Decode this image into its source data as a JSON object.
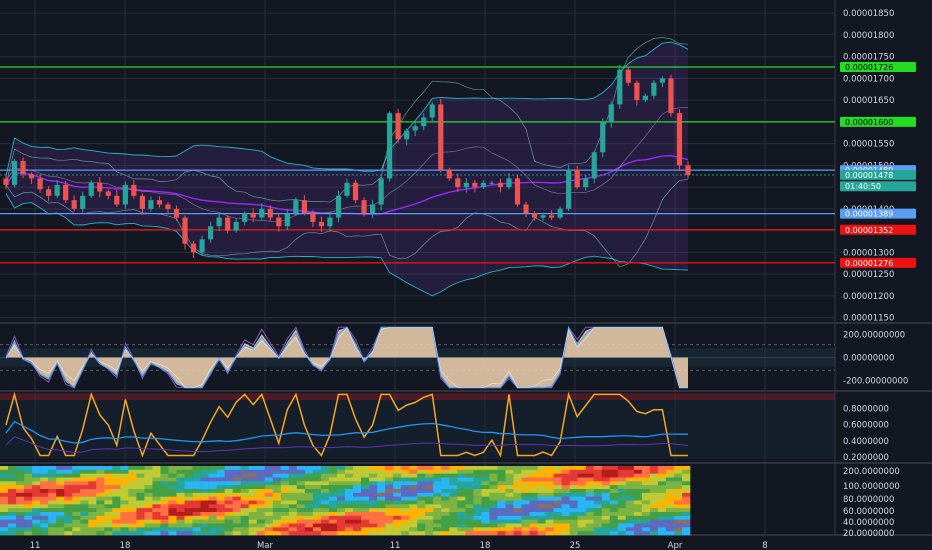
{
  "chart_data": [
    {
      "type": "candlestick",
      "panel": "price",
      "y_axis_ticks": [
        "0.00001850",
        "0.00001800",
        "0.00001750",
        "0.00001700",
        "0.00001650",
        "0.00001600",
        "0.00001550",
        "0.00001500",
        "0.00001450",
        "0.00001400",
        "0.00001350",
        "0.00001300",
        "0.00001250",
        "0.00001200",
        "0.00001150"
      ],
      "ylim": [
        1.14e-05,
        1.88e-05
      ],
      "x_axis_ticks": [
        "11",
        "18",
        "Mar",
        "11",
        "18",
        "25",
        "Apr",
        "8"
      ],
      "horizontal_levels": [
        {
          "value": 1.726e-05,
          "label": "0.00001726",
          "color": "#22dd22"
        },
        {
          "value": 1.6e-05,
          "label": "0.00001600",
          "color": "#22dd22"
        },
        {
          "value": 1.489e-05,
          "label": "0.00001489",
          "color": "#5b9cf6"
        },
        {
          "value": 1.389e-05,
          "label": "0.00001389",
          "color": "#5b9cf6"
        },
        {
          "value": 1.352e-05,
          "label": "0.00001352",
          "color": "#ee1111"
        },
        {
          "value": 1.276e-05,
          "label": "0.00001276",
          "color": "#ee1111"
        }
      ],
      "price_tags": [
        {
          "value": 1.478e-05,
          "label": "0.00001478",
          "color": "#26a69a"
        },
        {
          "value": 1.452e-05,
          "label": "01:40:50",
          "color": "#26a69a"
        }
      ],
      "candle_closes": [
        1.455e-05,
        1.51e-05,
        1.48e-05,
        1.47e-05,
        1.445e-05,
        1.43e-05,
        1.455e-05,
        1.42e-05,
        1.4e-05,
        1.43e-05,
        1.46e-05,
        1.44e-05,
        1.43e-05,
        1.41e-05,
        1.455e-05,
        1.43e-05,
        1.4e-05,
        1.42e-05,
        1.41e-05,
        1.4e-05,
        1.38e-05,
        1.32e-05,
        1.3e-05,
        1.33e-05,
        1.36e-05,
        1.38e-05,
        1.35e-05,
        1.37e-05,
        1.39e-05,
        1.38e-05,
        1.4e-05,
        1.38e-05,
        1.36e-05,
        1.39e-05,
        1.42e-05,
        1.39e-05,
        1.37e-05,
        1.36e-05,
        1.38e-05,
        1.43e-05,
        1.46e-05,
        1.42e-05,
        1.39e-05,
        1.41e-05,
        1.47e-05,
        1.62e-05,
        1.56e-05,
        1.58e-05,
        1.59e-05,
        1.61e-05,
        1.64e-05,
        1.49e-05,
        1.47e-05,
        1.45e-05,
        1.46e-05,
        1.45e-05,
        1.46e-05,
        1.46e-05,
        1.45e-05,
        1.47e-05,
        1.41e-05,
        1.39e-05,
        1.38e-05,
        1.385e-05,
        1.38e-05,
        1.4e-05,
        1.49e-05,
        1.45e-05,
        1.47e-05,
        1.53e-05,
        1.6e-05,
        1.64e-05,
        1.72e-05,
        1.69e-05,
        1.65e-05,
        1.66e-05,
        1.69e-05,
        1.7e-05,
        1.62e-05,
        1.5e-05,
        1.478e-05
      ]
    },
    {
      "type": "line",
      "panel": "oscillator",
      "y_axis_ticks": [
        "200.00000000",
        "0.00000000",
        "-200.00000000"
      ],
      "ylim": [
        -280,
        280
      ]
    },
    {
      "type": "line",
      "panel": "stochastic",
      "y_axis_ticks": [
        "0.8000000",
        "0.6000000",
        "0.4000000",
        "0.2000000"
      ],
      "ylim": [
        0.14,
        1.0
      ]
    },
    {
      "type": "heatmap",
      "panel": "cycles",
      "y_axis_ticks": [
        "200.0000000",
        "100.0000000",
        "80.0000000",
        "60.0000000",
        "40.0000000",
        "20.0000000"
      ]
    }
  ],
  "colors": {
    "background": "#131722",
    "bull": "#26a69a",
    "bear": "#ef5350",
    "grid": "#2a2e39",
    "text": "#d1d4dc"
  }
}
